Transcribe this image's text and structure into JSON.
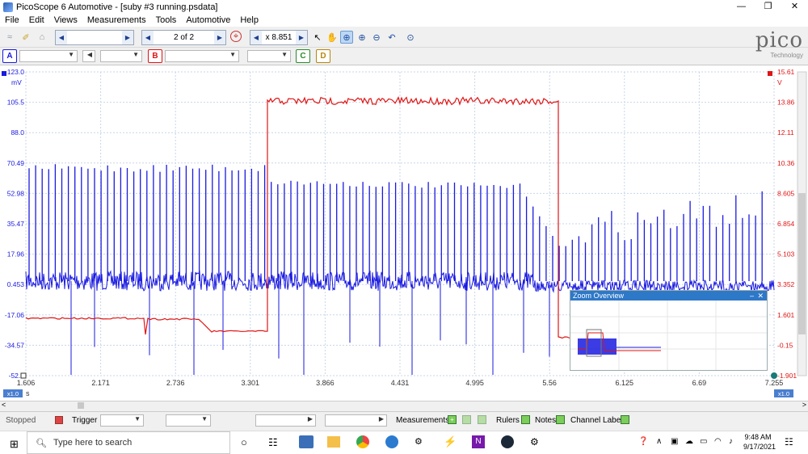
{
  "window": {
    "title": "PicoScope 6 Automotive - [suby #3 running.psdata]",
    "buttons": [
      "—",
      "❐",
      "✕"
    ]
  },
  "menu": [
    "File",
    "Edit",
    "Views",
    "Measurements",
    "Tools",
    "Automotive",
    "Help"
  ],
  "toolbar": {
    "page_indicator": "2 of 2",
    "zoom_value": "x 8.851",
    "logo_text": "pico",
    "logo_sub": "Technology"
  },
  "channels": {
    "a": "A",
    "b": "B",
    "c": "C",
    "d": "D"
  },
  "scope": {
    "left_axis": {
      "unit": "mV",
      "ticks": [
        "123.0",
        "105.5",
        "88.0",
        "70.49",
        "52.98",
        "35.47",
        "17.96",
        "0.453",
        "-17.06",
        "-34.57",
        "-52.0"
      ],
      "color": "#1a1ae0"
    },
    "right_axis": {
      "unit": "V",
      "ticks": [
        "15.61",
        "13.86",
        "12.11",
        "10.36",
        "8.605",
        "6.854",
        "5.103",
        "3.352",
        "1.601",
        "-0.15",
        "-1.901"
      ],
      "color": "#e01414"
    },
    "x_axis": {
      "unit": "s",
      "ticks": [
        "1.606",
        "2.171",
        "2.736",
        "3.301",
        "3.866",
        "4.431",
        "4.995",
        "5.56",
        "6.125",
        "6.69",
        "7.255"
      ],
      "scale_left": "x1.0",
      "scale_right": "x1.0"
    },
    "zoom_overview": {
      "title": "Zoom Overview"
    }
  },
  "status": {
    "state": "Stopped",
    "trigger": "Trigger",
    "measurements": "Measurements",
    "rulers": "Rulers",
    "notes": "Notes",
    "channel_labels": "Channel Labels"
  },
  "taskbar": {
    "search_placeholder": "Type here to search",
    "time": "9:48 AM",
    "date": "9/17/2021"
  },
  "colors": {
    "channel_a": "#1a1ae0",
    "channel_b": "#e01414",
    "grid": "#c8d6e8"
  }
}
